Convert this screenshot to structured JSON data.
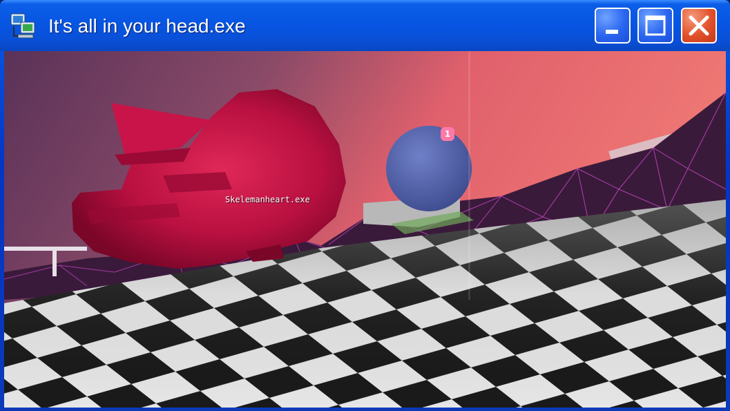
{
  "window": {
    "title": "It's all in your head.exe",
    "icon": "computer-network-icon",
    "controls": {
      "minimize": "minimize-icon",
      "maximize": "maximize-icon",
      "close": "close-icon"
    }
  },
  "game": {
    "object_label": "Skelemanheart.exe",
    "marker_count": "1"
  },
  "colors": {
    "titlebar_blue": "#0756e3",
    "sky_pink": "#e8606e",
    "sky_purple": "#5a3258",
    "head_red": "#b81040",
    "sphere_blue": "#5a6ab0",
    "wireframe_magenta": "#d04ad0",
    "marker_pink": "#ff78a8"
  }
}
